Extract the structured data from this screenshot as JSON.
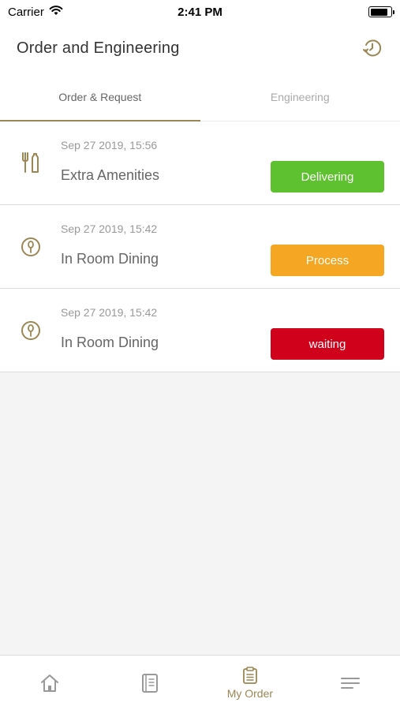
{
  "status_bar": {
    "carrier": "Carrier",
    "time": "2:41 PM"
  },
  "header": {
    "title": "Order and Engineering",
    "history_icon": "history-clock-icon"
  },
  "tabs": [
    {
      "label": "Order & Request",
      "active": true
    },
    {
      "label": "Engineering",
      "active": false
    }
  ],
  "orders": [
    {
      "date": "Sep 27 2019, 15:56",
      "name": "Extra Amenities",
      "status": "Delivering",
      "status_color": "#5ec12f",
      "icon": "amenities-icon"
    },
    {
      "date": "Sep 27 2019, 15:42",
      "name": "In Room Dining",
      "status": "Process",
      "status_color": "#f5a623",
      "icon": "dining-icon"
    },
    {
      "date": "Sep 27 2019, 15:42",
      "name": "In Room Dining",
      "status": "waiting",
      "status_color": "#d0021b",
      "icon": "dining-icon"
    }
  ],
  "tab_bar": {
    "items": [
      {
        "icon": "home-icon",
        "label": ""
      },
      {
        "icon": "directory-icon",
        "label": ""
      },
      {
        "icon": "clipboard-icon",
        "label": "My Order"
      },
      {
        "icon": "menu-icon",
        "label": ""
      }
    ]
  },
  "colors": {
    "accent": "#9b8654"
  }
}
